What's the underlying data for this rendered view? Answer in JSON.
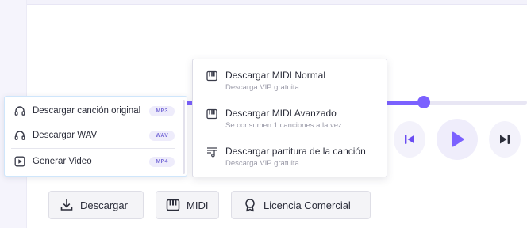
{
  "player": {
    "progress": 0.7,
    "accent_color": "#7b61ff",
    "controls": {
      "prev_icon": "skip-previous-icon",
      "play_icon": "play-icon",
      "next_icon": "skip-next-icon"
    }
  },
  "download_menu": {
    "items": [
      {
        "label": "Descargar canción original",
        "badge": "MP3",
        "icon": "headphones-icon"
      },
      {
        "label": "Descargar WAV",
        "badge": "WAV",
        "icon": "headphones-icon"
      },
      {
        "label": "Generar Video",
        "badge": "MP4",
        "icon": "video-play-icon"
      }
    ]
  },
  "midi_menu": {
    "items": [
      {
        "title": "Descargar MIDI Normal",
        "subtitle": "Descarga VIP gratuita",
        "icon": "piano-icon"
      },
      {
        "title": "Descargar MIDI Avanzado",
        "subtitle": "Se consumen 1 canciones a la vez",
        "icon": "piano-icon"
      },
      {
        "title": "Descargar partitura de la canción",
        "subtitle": "Descarga VIP gratuita",
        "icon": "sheet-music-icon"
      }
    ]
  },
  "actions": {
    "download_label": "Descargar",
    "midi_label": "MIDI",
    "license_label": "Licencia Comercial"
  }
}
